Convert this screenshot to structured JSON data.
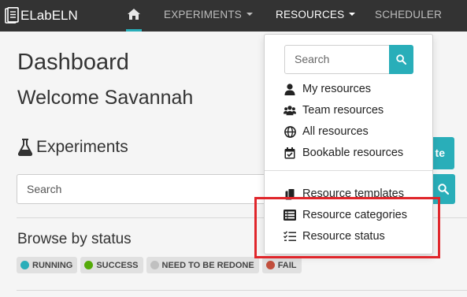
{
  "app": {
    "brand": "ELabELN"
  },
  "nav": {
    "home_icon": "home-icon",
    "experiments": "EXPERIMENTS",
    "resources": "RESOURCES",
    "scheduler": "SCHEDULER",
    "accent_color": "#29aeb9"
  },
  "page": {
    "title": "Dashboard",
    "welcome": "Welcome Savannah",
    "experiments_heading": "Experiments",
    "create_button": "te",
    "search_placeholder": "Search",
    "browse_heading": "Browse by status",
    "statuses": [
      {
        "label": "RUNNING",
        "color": "#29aeb9"
      },
      {
        "label": "SUCCESS",
        "color": "#54aa08"
      },
      {
        "label": "NEED TO BE REDONE",
        "color": "#c0c0c0"
      },
      {
        "label": "FAIL",
        "color": "#c24f3d"
      }
    ]
  },
  "resources_menu": {
    "search_placeholder": "Search",
    "items": [
      {
        "label": "My resources",
        "icon": "user-icon"
      },
      {
        "label": "Team resources",
        "icon": "users-icon"
      },
      {
        "label": "All resources",
        "icon": "globe-icon"
      },
      {
        "label": "Bookable resources",
        "icon": "calendar-check-icon"
      }
    ],
    "admin_items": [
      {
        "label": "Resource templates",
        "icon": "copy-icon"
      },
      {
        "label": "Resource categories",
        "icon": "list-icon"
      },
      {
        "label": "Resource status",
        "icon": "list-check-icon"
      }
    ],
    "highlight_color": "#e0262b"
  }
}
